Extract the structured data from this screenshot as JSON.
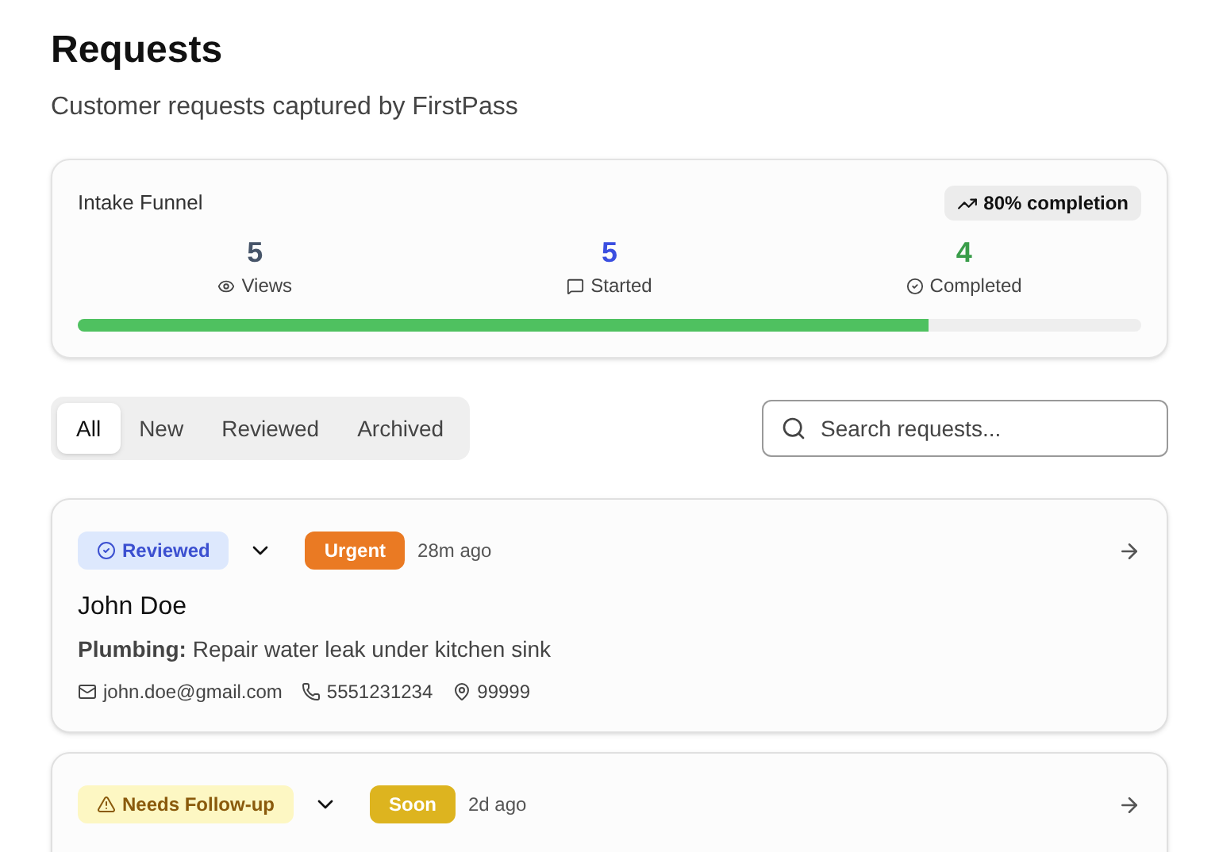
{
  "header": {
    "title": "Requests",
    "subtitle": "Customer requests captured by FirstPass"
  },
  "funnel": {
    "title": "Intake Funnel",
    "badge": "80% completion",
    "level": 0.8,
    "stats": [
      {
        "kind": "views",
        "value": "5",
        "label": "Views"
      },
      {
        "kind": "started",
        "value": "5",
        "label": "Started"
      },
      {
        "kind": "completed",
        "value": "4",
        "label": "Completed"
      }
    ]
  },
  "tabs": [
    {
      "label": "All",
      "selected": true
    },
    {
      "label": "New",
      "selected": false
    },
    {
      "label": "Reviewed",
      "selected": false
    },
    {
      "label": "Archived",
      "selected": false
    }
  ],
  "search": {
    "placeholder": "Search requests..."
  },
  "requests": [
    {
      "status": {
        "kind": "reviewed",
        "label": "Reviewed"
      },
      "priority": {
        "kind": "urgent",
        "label": "Urgent"
      },
      "time": "28m ago",
      "name": "John Doe",
      "category": "Plumbing:",
      "description": "Repair water leak under kitchen sink",
      "email": "john.doe@gmail.com",
      "phone": "5551231234",
      "zip": "99999"
    },
    {
      "status": {
        "kind": "followup",
        "label": "Needs Follow-up"
      },
      "priority": {
        "kind": "soon",
        "label": "Soon"
      },
      "time": "2d ago"
    }
  ]
}
